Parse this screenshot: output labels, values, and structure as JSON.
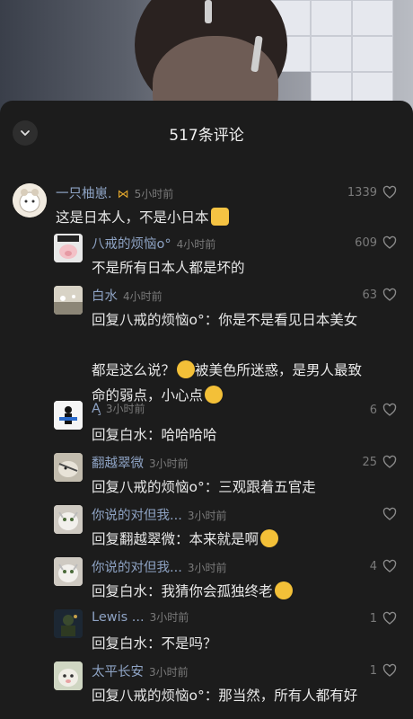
{
  "header": {
    "title": "517条评论"
  },
  "comments": [
    {
      "user": "一只柚崽.",
      "time": "5小时前",
      "likes": "1339",
      "text": "这是日本人，不是小日本"
    },
    {
      "user": "八戒的烦恼o°",
      "time": "4小时前",
      "likes": "609",
      "text": "不是所有日本人都是坏的"
    },
    {
      "user": "白水",
      "time": "4小时前",
      "likes": "63",
      "text": "回复八戒的烦恼o°：你是不是看见日本美女",
      "text2": "都是这么说？",
      "text3": "被美色所迷惑，是男人最致",
      "text4": "命的弱点，小心点"
    },
    {
      "user": "A̧",
      "time": "3小时前",
      "likes": "6",
      "text": "回复白水：哈哈哈哈"
    },
    {
      "user": "翻越翠微",
      "time": "3小时前",
      "likes": "25",
      "text": "回复八戒的烦恼o°：三观跟着五官走"
    },
    {
      "user": "你说的对但我...",
      "time": "3小时前",
      "likes": "",
      "text": "回复翻越翠微：本来就是啊"
    },
    {
      "user": "你说的对但我...",
      "time": "3小时前",
      "likes": "4",
      "text": "回复白水：我猜你会孤独终老"
    },
    {
      "user": "Lewis ...",
      "time": "3小时前",
      "likes": "1",
      "text": "回复白水：不是吗？"
    },
    {
      "user": "太平长安",
      "time": "3小时前",
      "likes": "1",
      "text": "回复八戒的烦恼o°：那当然，所有人都有好"
    }
  ],
  "icons": {
    "collapse": "chevron-down-icon",
    "like": "heart-outline-icon",
    "badge": "butterfly-icon"
  },
  "colors": {
    "username": "#8ea3c4",
    "text": "#e9e9e9",
    "meta": "#7a7a7a",
    "sheet": "#1c1c1c"
  }
}
